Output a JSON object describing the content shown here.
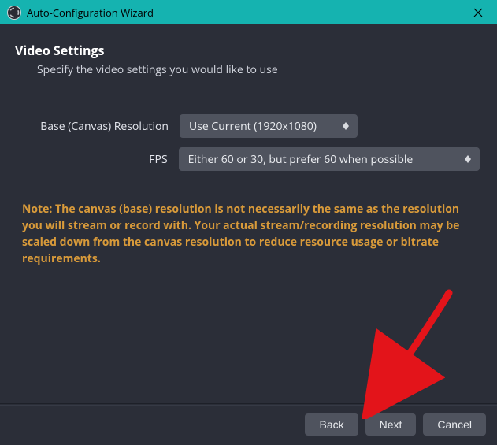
{
  "titlebar": {
    "title": "Auto-Configuration Wizard"
  },
  "header": {
    "title": "Video Settings",
    "subtitle": "Specify the video settings you would like to use"
  },
  "form": {
    "resolution_label": "Base (Canvas) Resolution",
    "resolution_value": "Use Current (1920x1080)",
    "fps_label": "FPS",
    "fps_value": "Either 60 or 30, but prefer 60 when possible"
  },
  "note_text": "Note: The canvas (base) resolution is not necessarily the same as the resolution you will stream or record with. Your actual stream/recording resolution may be scaled down from the canvas resolution to reduce resource usage or bitrate requirements.",
  "buttons": {
    "back": "Back",
    "next": "Next",
    "cancel": "Cancel"
  }
}
